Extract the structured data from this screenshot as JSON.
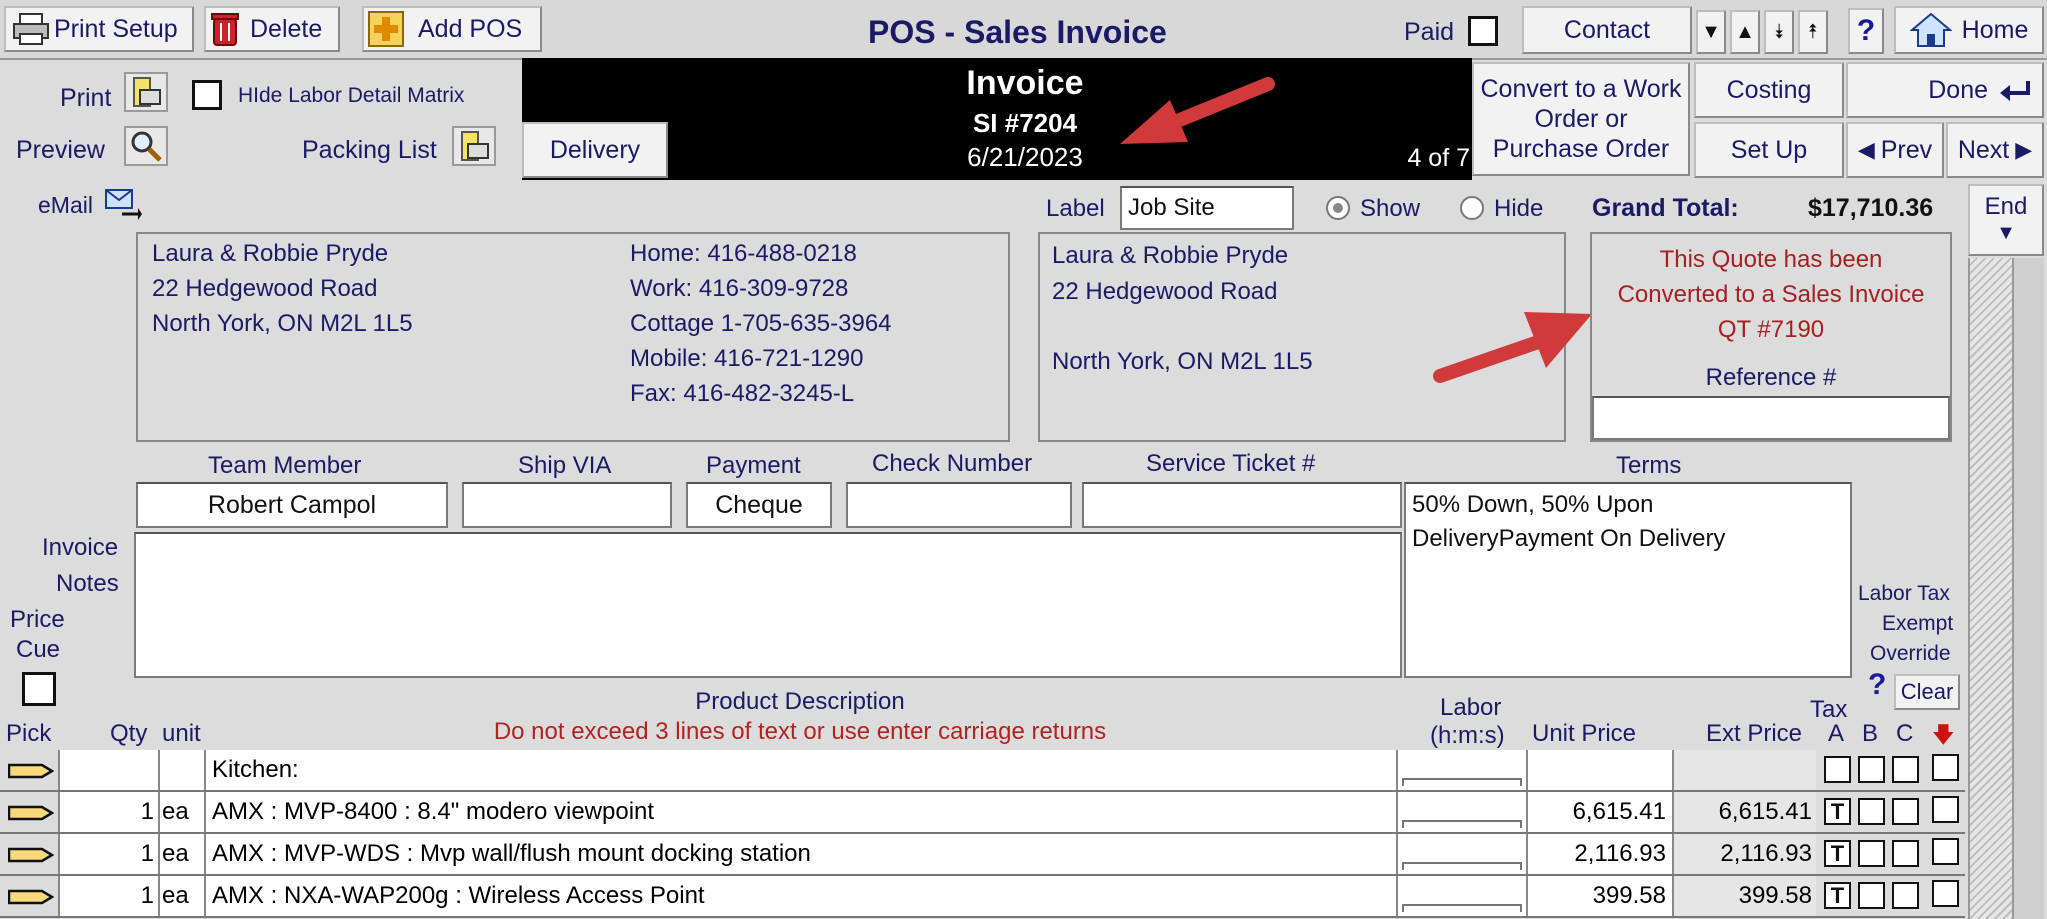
{
  "toolbar": {
    "print_setup": "Print Setup",
    "delete": "Delete",
    "add_pos": "Add POS",
    "title": "POS - Sales Invoice",
    "paid": "Paid",
    "contact": "Contact",
    "help": "?",
    "home": "Home"
  },
  "actions": {
    "print": "Print",
    "preview": "Preview",
    "hide_labor": "HIde Labor Detail Matrix",
    "packing_list": "Packing List",
    "delivery": "Delivery",
    "convert": "Convert to a Work Order or Purchase Order",
    "costing": "Costing",
    "done": "Done",
    "setup": "Set Up",
    "prev": "Prev",
    "next": "Next",
    "end": "End"
  },
  "header_panel": {
    "doc_type": "Invoice",
    "number": "SI #7204",
    "date": "6/21/2023",
    "record": "4 of 7"
  },
  "email_label": "eMail",
  "label_field": {
    "label": "Label",
    "value": "Job Site",
    "show": "Show",
    "hide": "Hide"
  },
  "grand_total": {
    "label": "Grand Total:",
    "value": "$17,710.36"
  },
  "customer": {
    "name": "Laura & Robbie Pryde",
    "address1": "22 Hedgewood Road",
    "city": "North York, ON M2L 1L5",
    "home": "Home: 416-488-0218",
    "work": "Work: 416-309-9728",
    "cottage": "Cottage 1-705-635-3964",
    "mobile": "Mobile: 416-721-1290",
    "fax": "Fax: 416-482-3245-L"
  },
  "ship_to": {
    "name": "Laura & Robbie Pryde",
    "address1": "22 Hedgewood Road",
    "city": "North York, ON M2L 1L5"
  },
  "quote_note": {
    "line1": "This Quote has been",
    "line2": "Converted to a Sales Invoice",
    "line3": "QT #7190",
    "reference_label": "Reference #"
  },
  "fields": {
    "team_member_label": "Team Member",
    "team_member": "Robert Campol",
    "ship_via_label": "Ship VIA",
    "ship_via": "",
    "payment_label": "Payment",
    "payment": "Cheque",
    "check_number_label": "Check Number",
    "check_number": "",
    "service_ticket_label": "Service Ticket #",
    "service_ticket": "",
    "terms_label": "Terms",
    "terms_line1": "50% Down, 50% Upon",
    "terms_line2": "DeliveryPayment On Delivery",
    "invoice_notes_label1": "Invoice",
    "invoice_notes_label2": "Notes",
    "price_cue_label1": "Price",
    "price_cue_label2": "Cue",
    "labor_tax_label1": "Labor Tax",
    "labor_tax_label2": "Exempt",
    "labor_tax_label3": "Override",
    "clear": "Clear"
  },
  "table": {
    "headers": {
      "pick": "Pick",
      "qty": "Qty",
      "unit": "unit",
      "desc": "Product Description",
      "desc_warning": "Do not exceed 3 lines of text or use enter carriage returns",
      "labor1": "Labor",
      "labor2": "(h:m:s)",
      "unit_price": "Unit Price",
      "ext_price": "Ext Price",
      "tax": "Tax",
      "a": "A",
      "b": "B",
      "c": "C"
    },
    "rows": [
      {
        "qty": "",
        "unit": "",
        "desc": "Kitchen:",
        "labor": "",
        "unit_price": "",
        "ext_price": "",
        "tax_a": ""
      },
      {
        "qty": "1",
        "unit": "ea",
        "desc": "AMX : MVP-8400 : 8.4\" modero viewpoint",
        "labor": "",
        "unit_price": "6,615.41",
        "ext_price": "6,615.41",
        "tax_a": "T"
      },
      {
        "qty": "1",
        "unit": "ea",
        "desc": "AMX : MVP-WDS : Mvp wall/flush mount docking station",
        "labor": "",
        "unit_price": "2,116.93",
        "ext_price": "2,116.93",
        "tax_a": "T"
      },
      {
        "qty": "1",
        "unit": "ea",
        "desc": "AMX : NXA-WAP200g : Wireless Access Point",
        "labor": "",
        "unit_price": "399.58",
        "ext_price": "399.58",
        "tax_a": "T"
      }
    ]
  },
  "colors": {
    "header_bg": "#000000",
    "accent_red": "#b22222",
    "label_blue": "#1a1a66",
    "arrow": "#d03a3a"
  }
}
